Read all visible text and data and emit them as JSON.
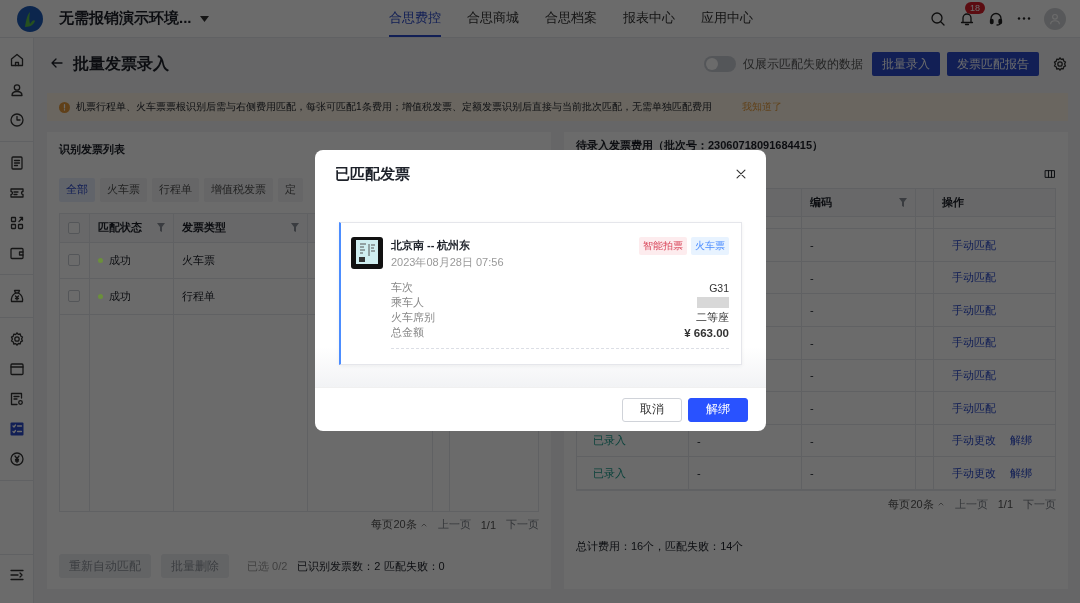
{
  "app_header": {
    "workspace": "无需报销演示环境...",
    "nav": [
      {
        "label": "合思费控",
        "selected": true
      },
      {
        "label": "合思商城",
        "selected": false
      },
      {
        "label": "合思档案",
        "selected": false
      },
      {
        "label": "报表中心",
        "selected": false
      },
      {
        "label": "应用中心",
        "selected": false
      }
    ],
    "notification_badge": "18"
  },
  "sidebar": {
    "groups": [
      [
        {
          "kind": "home",
          "selected": false
        },
        {
          "kind": "user",
          "selected": false
        },
        {
          "kind": "clock",
          "selected": false
        }
      ],
      [
        {
          "kind": "document",
          "selected": false
        },
        {
          "kind": "ticket",
          "selected": false
        },
        {
          "kind": "apps",
          "selected": false
        },
        {
          "kind": "wallet",
          "selected": false
        }
      ],
      [
        {
          "kind": "moneybag",
          "selected": false
        }
      ],
      [
        {
          "kind": "gear",
          "selected": false
        },
        {
          "kind": "folder",
          "selected": false
        },
        {
          "kind": "doc-settings",
          "selected": false
        },
        {
          "kind": "list",
          "selected": true
        },
        {
          "kind": "coin",
          "selected": false
        }
      ]
    ]
  },
  "page": {
    "title": "批量发票录入",
    "toggle": {
      "label": "仅展示匹配失败的数据",
      "on": false
    },
    "buttons": [
      "批量录入",
      "发票匹配报告"
    ]
  },
  "notice": {
    "text": "机票行程单、火车票票根识别后需与右侧费用匹配，每张可匹配1条费用；增值税发票、定额发票识别后直接与当前批次匹配，无需单独匹配费用",
    "link": "我知道了"
  },
  "left_panel": {
    "title": "识别发票列表",
    "filters": [
      {
        "label": "全部",
        "selected": true
      },
      {
        "label": "火车票",
        "selected": false
      },
      {
        "label": "行程单",
        "selected": false
      },
      {
        "label": "增值税发票",
        "selected": false
      },
      {
        "label": "定",
        "selected": false
      }
    ],
    "select_all_checked": false,
    "columns": [
      "匹配状态",
      "发票类型"
    ],
    "rows": [
      {
        "checked": false,
        "status": "成功",
        "color": "#6b8f3c",
        "type": "火车票"
      },
      {
        "checked": false,
        "status": "成功",
        "color": "#6b8f3c",
        "type": "行程单"
      }
    ],
    "pagination": {
      "page_size": "每页20条",
      "prev": "上一页",
      "page": "1/1",
      "next": "下一页"
    },
    "actions": [
      "重新自动匹配",
      "批量删除"
    ],
    "selected_count": "已选 0/2",
    "summary": "已识别发票数：2 匹配失败：0"
  },
  "right_panel": {
    "title": "待录入发票费用（批次号：23060718091684415）",
    "columns": {
      "code": "编码",
      "actions": "操作"
    },
    "rows": [
      {
        "code": "-",
        "actions": [
          "手动匹配"
        ]
      },
      {
        "code": "-",
        "actions": [
          "手动匹配"
        ]
      },
      {
        "code": "-",
        "actions": [
          "手动匹配"
        ]
      },
      {
        "code": "-",
        "actions": [
          "手动匹配"
        ]
      },
      {
        "code": "-",
        "actions": [
          "手动匹配"
        ]
      },
      {
        "code": "-",
        "actions": [
          "手动匹配"
        ]
      },
      {
        "status": "已录入",
        "column_2": "-",
        "code": "-",
        "actions": [
          "手动更改",
          "解绑"
        ]
      },
      {
        "status": "已录入",
        "column_2": "-",
        "code": "-",
        "actions": [
          "手动更改",
          "解绑"
        ]
      }
    ],
    "pagination": {
      "page_size": "每页20条",
      "prev": "上一页",
      "page": "1/1",
      "next": "下一页"
    },
    "summary": "总计费用：16个，匹配失败：14个"
  },
  "dialog": {
    "title": "已匹配发票",
    "invoice": {
      "route": "北京南 -- 杭州东",
      "datetime": "2023年08月28日 07:56",
      "tags": [
        {
          "label": "智能拍票",
          "kind": "source"
        },
        {
          "label": "火车票",
          "kind": "type"
        }
      ],
      "details": [
        {
          "label": "车次",
          "value": "G31",
          "redacted": false,
          "emphasis": false
        },
        {
          "label": "乘车人",
          "redacted": true
        },
        {
          "label": "火车席别",
          "value": "二等座",
          "redacted": false,
          "emphasis": false
        },
        {
          "label": "总金额",
          "value": "¥ 663.00",
          "redacted": false,
          "emphasis": true
        }
      ]
    },
    "buttons": [
      {
        "label": "取消",
        "kind": "secondary"
      },
      {
        "label": "解绑",
        "kind": "primary"
      }
    ]
  }
}
